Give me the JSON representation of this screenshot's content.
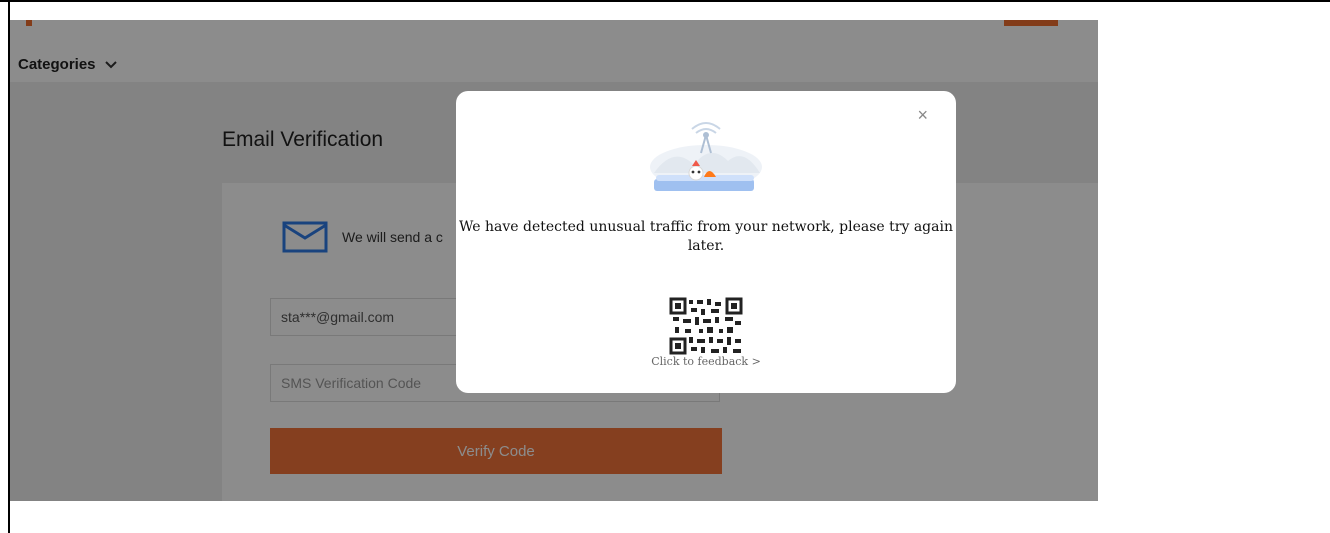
{
  "nav": {
    "categories_label": "Categories"
  },
  "page": {
    "title": "Email Verification"
  },
  "card": {
    "info_text": "We will send a c",
    "email_value": "sta***@gmail.com",
    "sms_placeholder": "SMS Verification Code",
    "verify_label": "Verify Code"
  },
  "modal": {
    "message": "We have detected unusual traffic from your network, please try again later.",
    "feedback_label": "Click to feedback >",
    "close_label": "×"
  },
  "colors": {
    "accent": "#f2743a",
    "mail_icon": "#2f7be6"
  },
  "icons": [
    "chevron-down-icon",
    "mail-icon",
    "close-icon",
    "network-illustration",
    "qr-code"
  ]
}
